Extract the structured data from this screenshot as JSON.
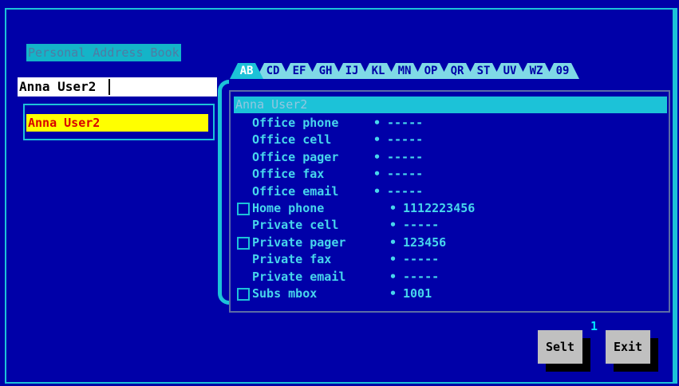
{
  "app": {
    "title": "Personal Address Book"
  },
  "search": {
    "value": "Anna User2"
  },
  "list": {
    "items": [
      "Anna User2"
    ]
  },
  "tabs": [
    "AB",
    "CD",
    "EF",
    "GH",
    "IJ",
    "KL",
    "MN",
    "OP",
    "QR",
    "ST",
    "UV",
    "WZ",
    "09"
  ],
  "active_tab": "AB",
  "detail": {
    "name": "Anna User2",
    "fields": [
      {
        "label": "Office phone",
        "value": "-----",
        "checkbox": false,
        "group": "office"
      },
      {
        "label": "Office cell",
        "value": "-----",
        "checkbox": false,
        "group": "office"
      },
      {
        "label": "Office pager",
        "value": "-----",
        "checkbox": false,
        "group": "office"
      },
      {
        "label": "Office fax",
        "value": "-----",
        "checkbox": false,
        "group": "office"
      },
      {
        "label": "Office email",
        "value": "-----",
        "checkbox": false,
        "group": "office"
      },
      {
        "label": "Home phone",
        "value": "1112223456",
        "checkbox": true,
        "group": "private"
      },
      {
        "label": "Private cell",
        "value": "-----",
        "checkbox": false,
        "group": "private"
      },
      {
        "label": "Private pager",
        "value": "123456",
        "checkbox": true,
        "group": "private"
      },
      {
        "label": "Private fax",
        "value": "-----",
        "checkbox": false,
        "group": "private"
      },
      {
        "label": "Private email",
        "value": "-----",
        "checkbox": false,
        "group": "private"
      },
      {
        "label": "Subs mbox",
        "value": "1001",
        "checkbox": true,
        "group": "private"
      }
    ]
  },
  "buttons": {
    "select": "Selt",
    "exit": "Exit",
    "badge": "1"
  },
  "colors": {
    "background": "#0000a8",
    "accent": "#1cc2d8",
    "highlight": "#ffff00",
    "highlight_text": "#d80000"
  }
}
